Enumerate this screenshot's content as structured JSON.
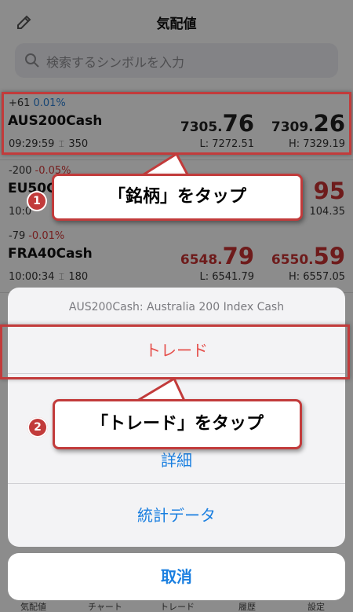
{
  "header": {
    "title": "気配値",
    "search_placeholder": "検索するシンボルを入力"
  },
  "quotes": [
    {
      "change": "+61",
      "change_pct": "0.01%",
      "direction": "up",
      "symbol": "AUS200Cash",
      "time": "09:29:59",
      "spread": "350",
      "bid_main": "7305.",
      "bid_big": "76",
      "ask_main": "7309.",
      "ask_big": "26",
      "low": "L: 7272.51",
      "high": "H: 7329.19"
    },
    {
      "change": "-200",
      "change_pct": "-0.05%",
      "direction": "down",
      "symbol": "EU50Ca",
      "time": "10:0",
      "ask_big": "95",
      "high_partial": "104.35"
    },
    {
      "change": "-79",
      "change_pct": "-0.01%",
      "direction": "down",
      "symbol": "FRA40Cash",
      "time": "10:00:34",
      "spread": "180",
      "bid_main": "6548.",
      "bid_big": "79",
      "ask_main": "6550.",
      "ask_big": "59",
      "low": "L: 6541.79",
      "high": "H: 6557.05"
    }
  ],
  "action_sheet": {
    "title": "AUS200Cash: Australia 200 Index Cash",
    "items": [
      "トレード",
      "詳細",
      "統計データ"
    ],
    "cancel": "取消"
  },
  "tabs": [
    "気配値",
    "チャート",
    "トレード",
    "履歴",
    "設定"
  ],
  "callouts": {
    "step1_number": "1",
    "step1_text": "「銘柄」をタップ",
    "step2_number": "2",
    "step2_text": "「トレード」をタップ"
  },
  "colors": {
    "up": "#2a7fd4",
    "down": "#c83232",
    "accent": "#1a7fe0",
    "annotation": "#c23b3b"
  }
}
